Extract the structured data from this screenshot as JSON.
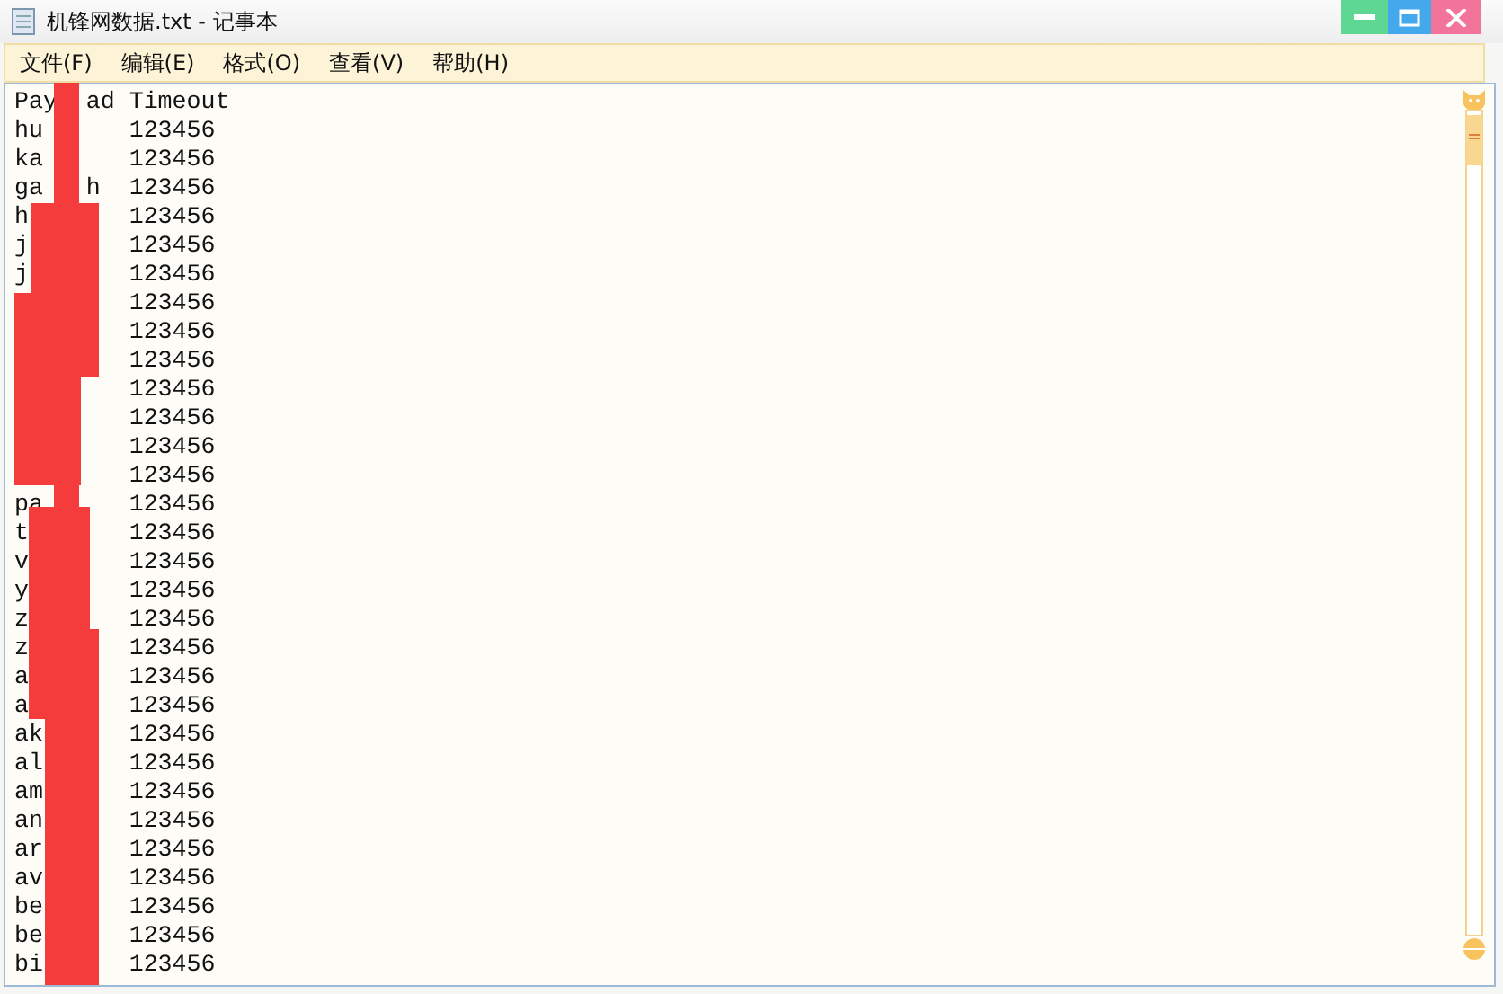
{
  "window": {
    "title": "机锋网数据.txt - 记事本"
  },
  "menu": [
    "文件(F)",
    "编辑(E)",
    "格式(O)",
    "查看(V)",
    "帮助(H)"
  ],
  "lines": [
    "Pay  ad Timeout",
    "hu      123456",
    "ka      123456",
    "ga   h  123456",
    "h       123456",
    "j       123456",
    "j       123456",
    "        123456",
    "        123456",
    "        123456",
    "        123456",
    "        123456",
    "        123456",
    "        123456",
    "pa      123456",
    "t       123456",
    "v       123456",
    "y       123456",
    "z       123456",
    "z       123456",
    "a       123456",
    "a       123456",
    "ak      123456",
    "al      123456",
    "am      123456",
    "an      123456",
    "ar      123456",
    "av      123456",
    "be      123456",
    "be      123456",
    "bi      123456"
  ]
}
